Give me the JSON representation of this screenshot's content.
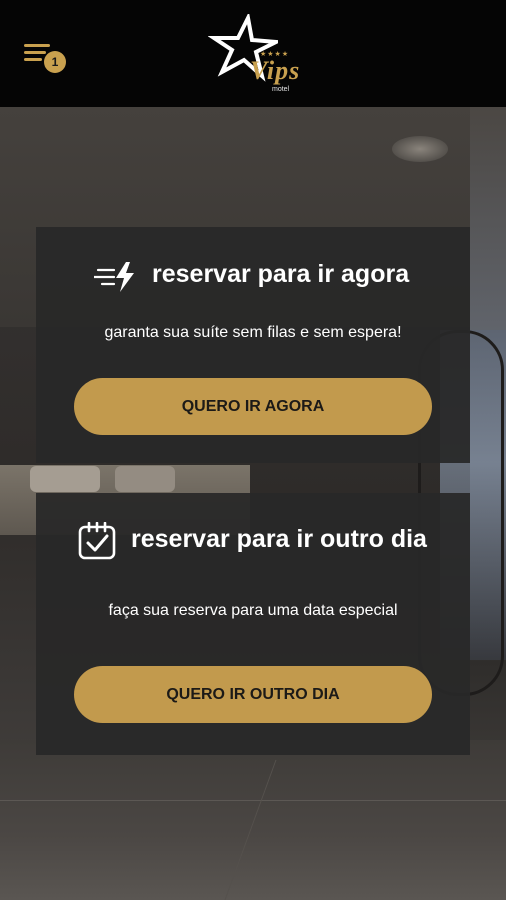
{
  "header": {
    "menu_icon": "menu-lines-icon",
    "notification_count": "1",
    "logo": {
      "text": "Vips",
      "subtext": "motel",
      "stars": "★★★★"
    }
  },
  "cards": [
    {
      "icon": "lightning-icon",
      "title": "reservar para ir agora",
      "subtitle": "garanta sua suíte sem filas e sem espera!",
      "button_label": "QUERO IR AGORA"
    },
    {
      "icon": "calendar-check-icon",
      "title": "reservar para ir outro dia",
      "subtitle": "faça sua reserva para uma data especial",
      "button_label": "QUERO IR OUTRO DIA"
    }
  ],
  "colors": {
    "accent": "#c29a4d",
    "topbar": "#050505",
    "card": "#282828"
  }
}
